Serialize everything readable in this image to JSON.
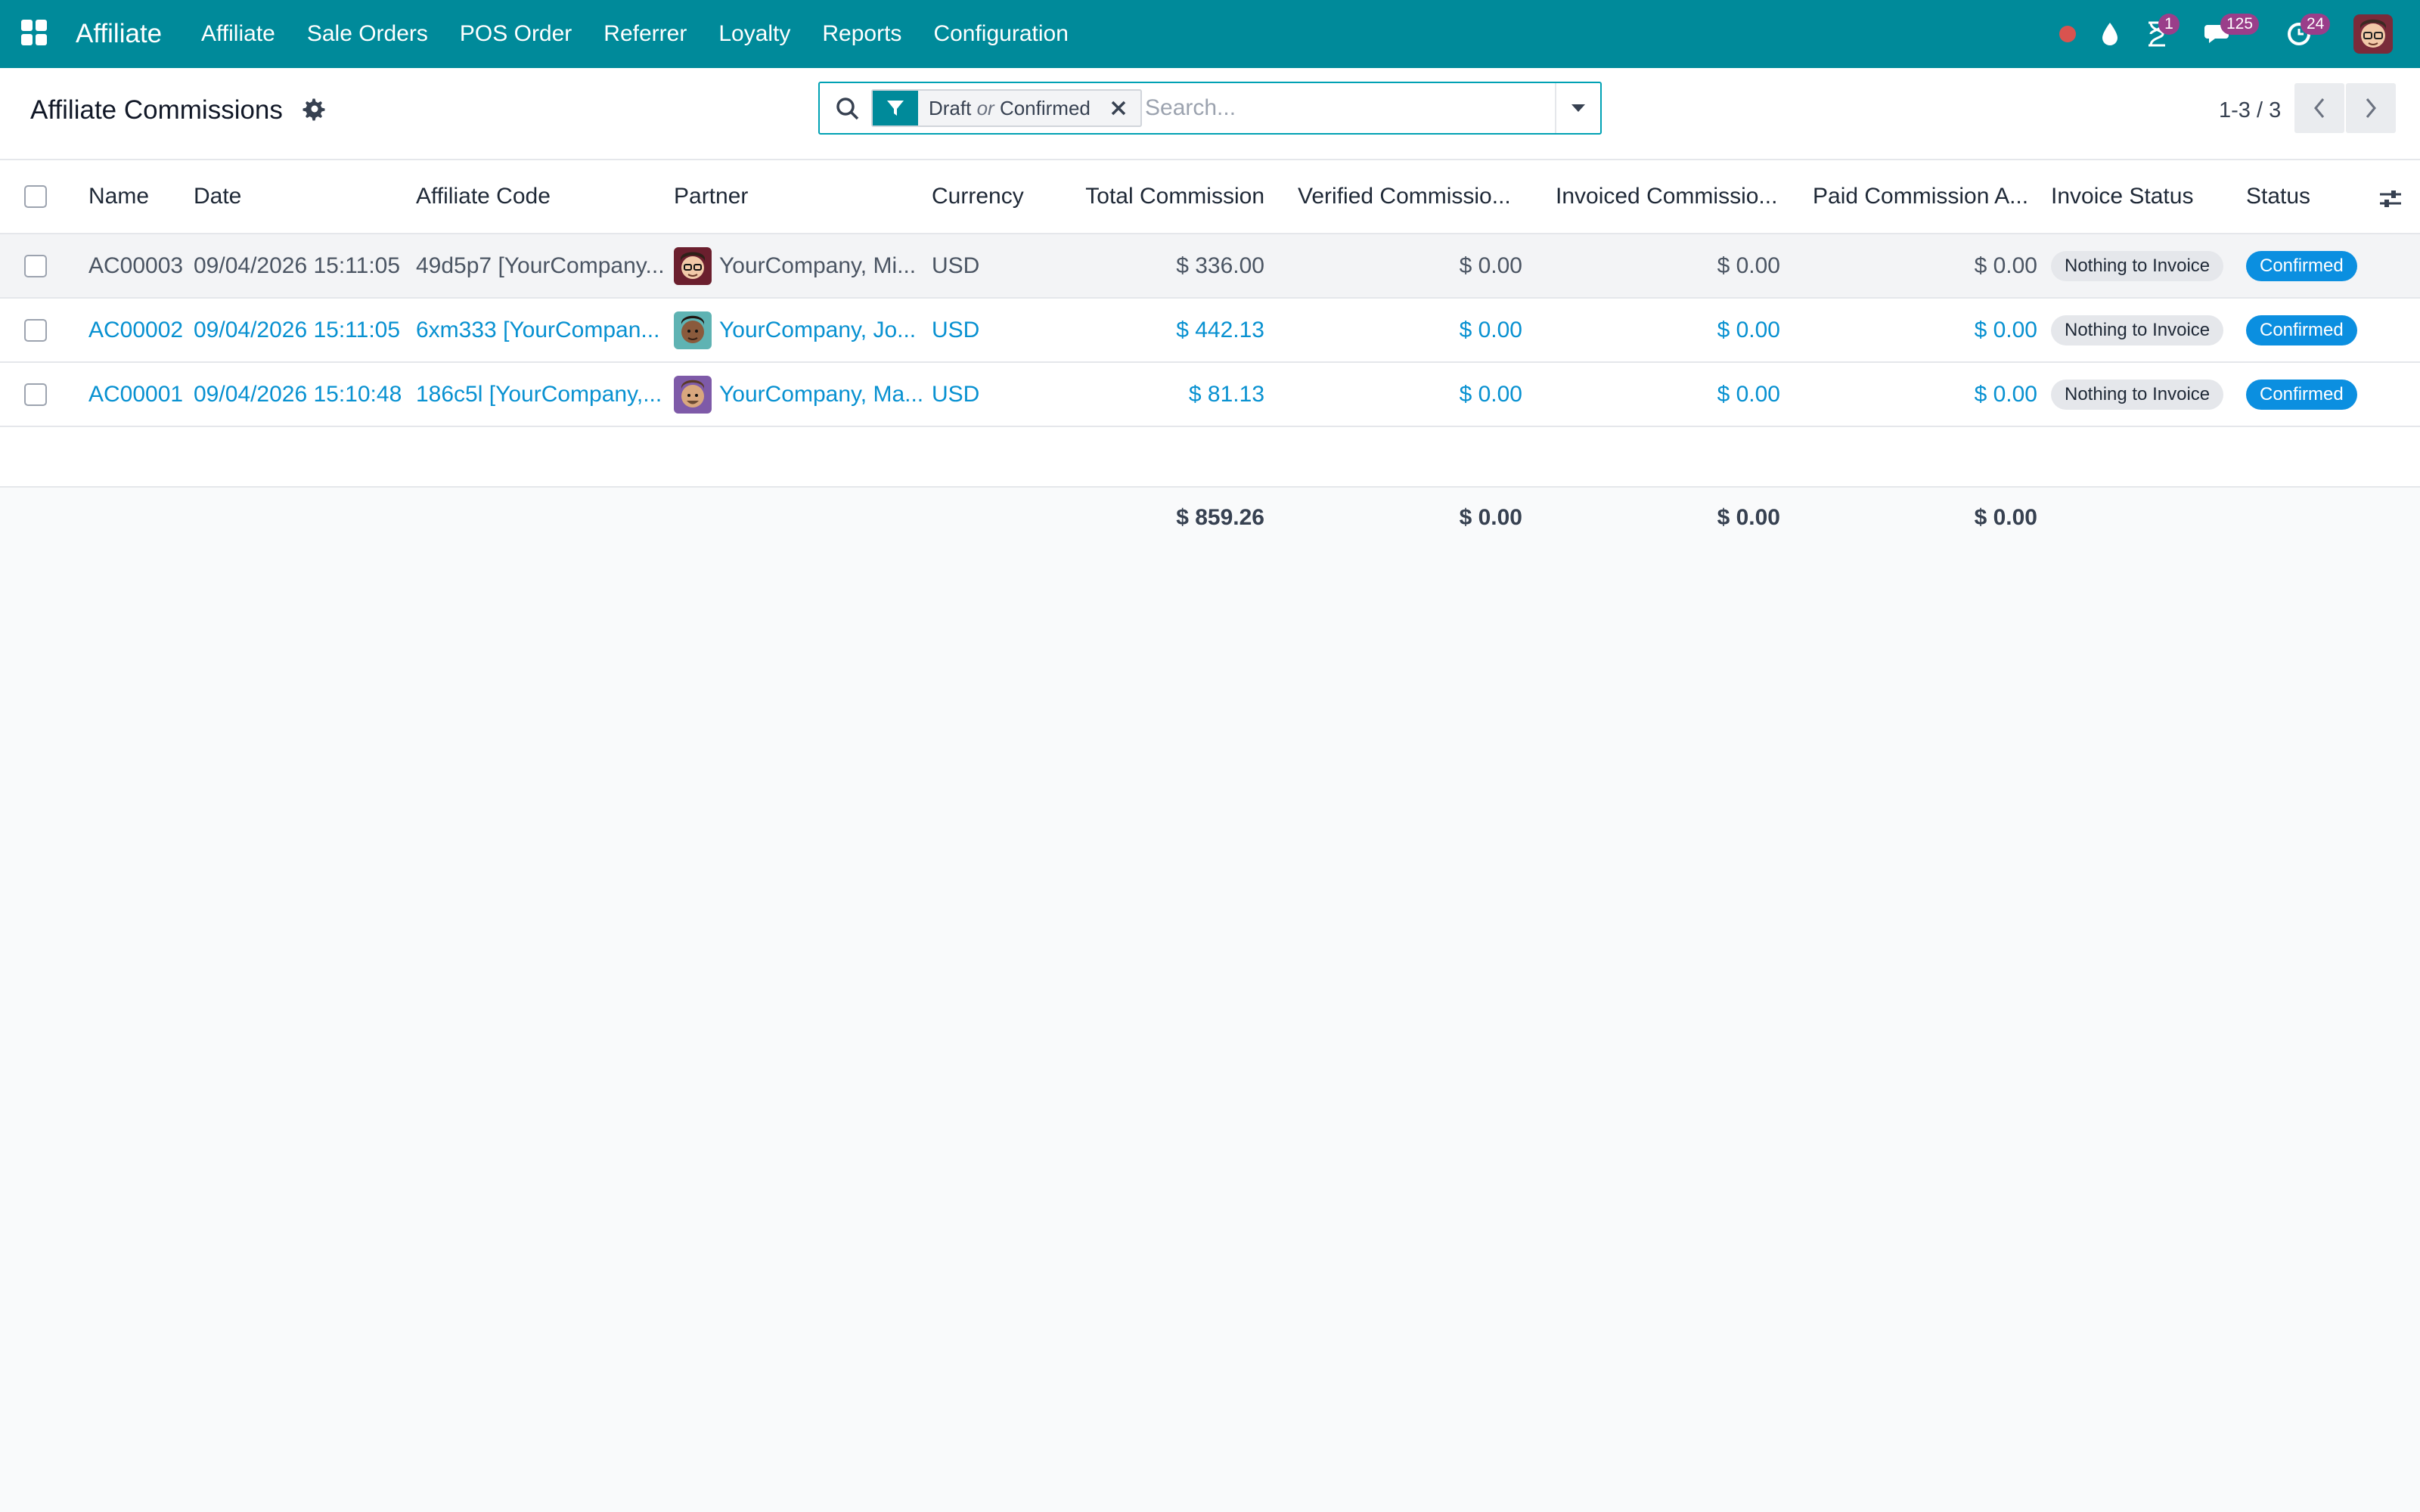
{
  "navbar": {
    "app_name": "Affiliate",
    "menu": [
      "Affiliate",
      "Sale Orders",
      "POS Order",
      "Referrer",
      "Loyalty",
      "Reports",
      "Configuration"
    ],
    "activity_count": "1",
    "messages_count": "125",
    "updates_count": "24",
    "colors": {
      "background": "#008a9a",
      "badge": "#9a3e8a",
      "status_dot": "#d9534f"
    }
  },
  "control_panel": {
    "title": "Affiliate Commissions",
    "facet": {
      "first": "Draft",
      "or": "or",
      "second": "Confirmed"
    },
    "search_placeholder": "Search...",
    "pager": "1-3 / 3"
  },
  "table": {
    "headers": {
      "name": "Name",
      "date": "Date",
      "affiliate_code": "Affiliate Code",
      "partner": "Partner",
      "currency": "Currency",
      "total": "Total Commission",
      "verified": "Verified Commissio...",
      "invoiced": "Invoiced Commissio...",
      "paid": "Paid Commission A...",
      "invoice_status": "Invoice Status",
      "status": "Status"
    },
    "rows": [
      {
        "name": "AC00003",
        "date": "09/04/2026 15:11:05",
        "affiliate_code": "49d5p7 [YourCompany...",
        "partner": "YourCompany, Mi...",
        "currency": "USD",
        "total": "$ 336.00",
        "verified": "$ 0.00",
        "invoiced": "$ 0.00",
        "paid": "$ 0.00",
        "invoice_status": "Nothing to Invoice",
        "status": "Confirmed"
      },
      {
        "name": "AC00002",
        "date": "09/04/2026 15:11:05",
        "affiliate_code": "6xm333 [YourCompan...",
        "partner": "YourCompany, Jo...",
        "currency": "USD",
        "total": "$ 442.13",
        "verified": "$ 0.00",
        "invoiced": "$ 0.00",
        "paid": "$ 0.00",
        "invoice_status": "Nothing to Invoice",
        "status": "Confirmed"
      },
      {
        "name": "AC00001",
        "date": "09/04/2026 15:10:48",
        "affiliate_code": "186c5l [YourCompany,...",
        "partner": "YourCompany, Ma...",
        "currency": "USD",
        "total": "$ 81.13",
        "verified": "$ 0.00",
        "invoiced": "$ 0.00",
        "paid": "$ 0.00",
        "invoice_status": "Nothing to Invoice",
        "status": "Confirmed"
      }
    ],
    "totals": {
      "total": "$ 859.26",
      "verified": "$ 0.00",
      "invoiced": "$ 0.00",
      "paid": "$ 0.00"
    }
  }
}
